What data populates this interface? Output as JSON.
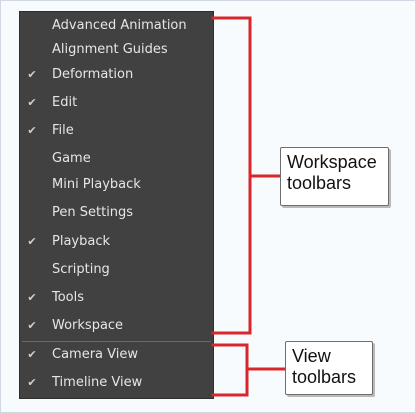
{
  "menu": {
    "items": [
      {
        "label": "Advanced Animation",
        "checked": false
      },
      {
        "label": "Alignment Guides",
        "checked": false
      },
      {
        "label": "Deformation",
        "checked": true
      },
      {
        "label": "Edit",
        "checked": true
      },
      {
        "label": "File",
        "checked": true
      },
      {
        "label": "Game",
        "checked": false
      },
      {
        "label": "Mini Playback",
        "checked": false
      },
      {
        "label": "Pen Settings",
        "checked": false
      },
      {
        "label": "Playback",
        "checked": true
      },
      {
        "label": "Scripting",
        "checked": false
      },
      {
        "label": "Tools",
        "checked": true
      },
      {
        "label": "Workspace",
        "checked": true
      },
      {
        "label": "Camera View",
        "checked": true
      },
      {
        "label": "Timeline View",
        "checked": true
      }
    ],
    "check_glyph": "✔"
  },
  "annotations": {
    "workspace_line1": "Workspace",
    "workspace_line2": "toolbars",
    "view_line1": "View",
    "view_line2": "toolbars",
    "bracket_color": "#d9262b"
  },
  "colors": {
    "menu_background": "#414141",
    "menu_text": "#e6e6e6"
  }
}
